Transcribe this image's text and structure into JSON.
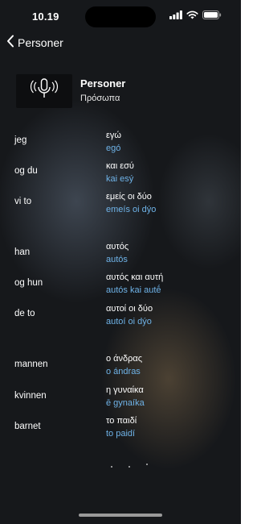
{
  "status_bar": {
    "time": "10.19",
    "icons": [
      "cellular-signal-icon",
      "wifi-icon",
      "battery-icon"
    ]
  },
  "nav": {
    "back_label": "Personer",
    "back_icon": "chevron-left-icon"
  },
  "header": {
    "thumbnail_icon": "microphone-sound-icon",
    "title": "Personer",
    "subtitle": "Πρόσωπα"
  },
  "vocab": [
    {
      "src": "jeg",
      "tgt": "εγώ",
      "translit": "egó"
    },
    {
      "src": "og du",
      "tgt": "και εσύ",
      "translit": "kai esý"
    },
    {
      "src": "vi to",
      "tgt": "εμείς οι δύο",
      "translit": "emeís oi dýo"
    },
    {
      "src": "han",
      "tgt": "αυτός",
      "translit": "autós"
    },
    {
      "src": "og hun",
      "tgt": "αυτός και αυτή",
      "translit": "autós kai autḗ"
    },
    {
      "src": "de to",
      "tgt": "αυτοί οι δύο",
      "translit": "autoí oi dýo"
    },
    {
      "src": "mannen",
      "tgt": "ο άνδρας",
      "translit": "o ándras"
    },
    {
      "src": "kvinnen",
      "tgt": "η γυναίκα",
      "translit": "ē gynaíka"
    },
    {
      "src": "barnet",
      "tgt": "το παιδί",
      "translit": "to paidí"
    }
  ],
  "colors": {
    "background": "#16181b",
    "translit": "#6fb3e8",
    "text": "#ffffff"
  }
}
